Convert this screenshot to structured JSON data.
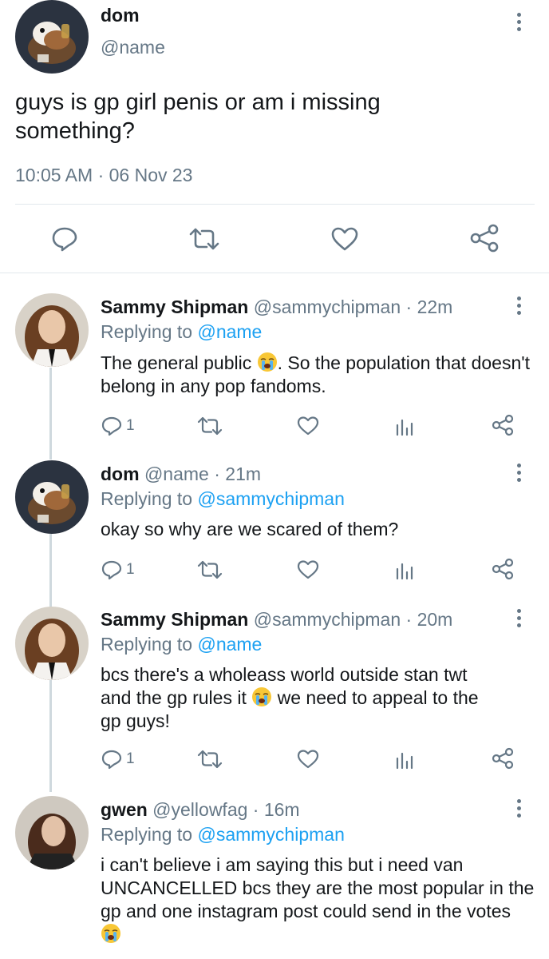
{
  "main_tweet": {
    "name": "dom",
    "handle": "@name",
    "text": "guys is gp girl penis or am i missing something?",
    "timestamp": "10:05 AM · 06 Nov 23",
    "actions": [
      "reply-icon",
      "retweet-icon",
      "like-icon",
      "share-icon"
    ]
  },
  "replies": [
    {
      "name": "Sammy Shipman",
      "handle": "@sammychipman",
      "time": "· 22m",
      "replying_prefix": "Replying to",
      "replying_to": "@name",
      "text_before_emoji": "The general public",
      "text_after_emoji": ". So the  population that doesn't belong in any pop fandoms.",
      "reply_count": "1"
    },
    {
      "name": "dom",
      "handle": "@name",
      "time": "· 21m",
      "replying_prefix": "Replying to",
      "replying_to": "@sammychipman",
      "text": "okay so why are we scared of them?",
      "reply_count": "1"
    },
    {
      "name": "Sammy Shipman",
      "handle": "@sammychipman",
      "time": "· 20m",
      "replying_prefix": "Replying to",
      "replying_to": "@name",
      "line1": "bcs there's a wholeass world outside stan twt",
      "line2_before": "and the gp rules it",
      "line2_after": " we need to appeal to the",
      "line3": "gp guys!",
      "reply_count": "1"
    },
    {
      "name": "gwen",
      "handle": "@yellowfag",
      "time": "· 16m",
      "replying_prefix": "Replying to",
      "replying_to": "@sammychipman",
      "text_before_emoji": "i can't believe i am saying this but i need van UNCANCELLED bcs they are the most popular in the gp and one instagram post could send in the votes",
      "text_after_emoji": ""
    }
  ],
  "colors": {
    "accent": "#1da1f2",
    "secondary_text": "#657786",
    "divider": "#e1e8ed"
  }
}
